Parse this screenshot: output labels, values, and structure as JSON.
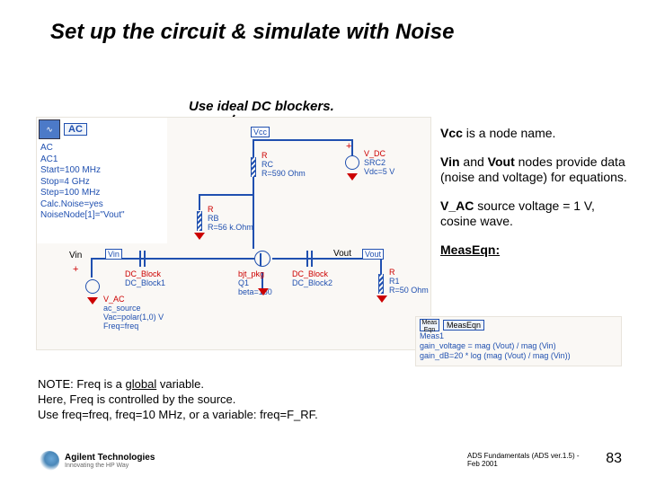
{
  "title": "Set up the circuit & simulate with Noise",
  "instruction": "Use ideal DC blockers.",
  "notes": {
    "vcc": {
      "bold": "Vcc",
      "rest": " is a node name."
    },
    "vinvout": {
      "bold1": "Vin",
      "mid": " and ",
      "bold2": "Vout",
      "rest": " nodes provide data (noise and voltage) for equations."
    },
    "vac": {
      "bold": "V_AC",
      "rest": " source voltage = 1 V, cosine wave."
    },
    "meas_label": "MeasEqn:"
  },
  "note_block": {
    "line1_a": "NOTE: Freq is a ",
    "line1_u": "global",
    "line1_b": " variable.",
    "line2": "Here, Freq is controlled by the source.",
    "line3": "Use freq=freq, freq=10 MHz, or a variable: freq=F_RF."
  },
  "sim": {
    "hdr_icon_text": "∿",
    "hdr_label": "AC",
    "lines": [
      "AC",
      "AC1",
      "Start=100 MHz",
      "Stop=4 GHz",
      "Step=100 MHz",
      "Calc.Noise=yes",
      "NoiseNode[1]=\"Vout\""
    ]
  },
  "circuit": {
    "vcc_node": "Vcc",
    "r_rc": {
      "l1": "R",
      "l2": "RC",
      "l3": "R=590 Ohm"
    },
    "r_rb": {
      "l1": "R",
      "l2": "RB",
      "l3": "R=56 k.Ohm"
    },
    "vdc": {
      "l1": "V_DC",
      "l2": "SRC2",
      "l3": "Vdc=5 V"
    },
    "bjt": {
      "l1": "bjt_pkg",
      "l2": "Q1",
      "l3": "beta=160"
    },
    "dcb1": {
      "l1": "DC_Block",
      "l2": "DC_Block1"
    },
    "dcb2": {
      "l1": "DC_Block",
      "l2": "DC_Block2"
    },
    "r_r1": {
      "l1": "R",
      "l2": "R1",
      "l3": "R=50 Ohm"
    },
    "vin_pin": "Vin",
    "vin_node": "Vin",
    "vout_pin": "Vout",
    "vout_node": "Vout",
    "vac": {
      "l1": "V_AC",
      "l2": "ac_source",
      "l3": "Vac=polar(1,0) V",
      "l4": "Freq=freq"
    }
  },
  "meas_box": {
    "hdr_icon": "Meas Eqn",
    "hdr_label": "MeasEqn",
    "lines": [
      "Meas1",
      "gain_voltage = mag (Vout) / mag (Vin)",
      "gain_dB=20 * log (mag (Vout) / mag (Vin))"
    ]
  },
  "footer": {
    "brand1": "Agilent Technologies",
    "brand2": "Innovating the HP Way",
    "credit": "ADS Fundamentals (ADS ver.1.5) - Feb 2001",
    "page": "83"
  }
}
